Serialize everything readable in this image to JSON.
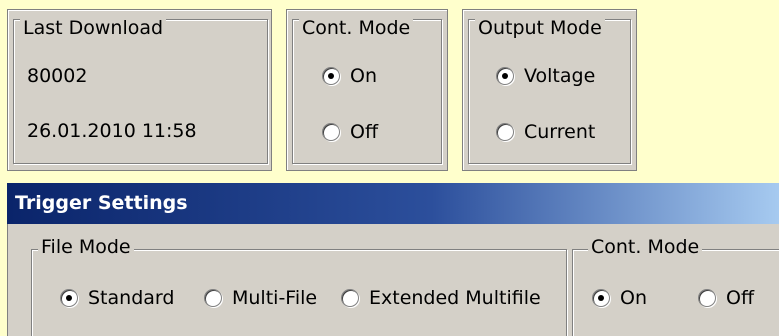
{
  "last_download": {
    "title": "Last Download",
    "id": "80002",
    "timestamp": "26.01.2010 11:58"
  },
  "cont_mode_top": {
    "title": "Cont. Mode",
    "options": [
      {
        "label": "On",
        "selected": true
      },
      {
        "label": "Off",
        "selected": false
      }
    ]
  },
  "output_mode": {
    "title": "Output Mode",
    "options": [
      {
        "label": "Voltage",
        "selected": true
      },
      {
        "label": "Current",
        "selected": false
      }
    ]
  },
  "trigger_settings": {
    "title": "Trigger Settings",
    "file_mode": {
      "title": "File Mode",
      "options": [
        {
          "label": "Standard",
          "selected": true
        },
        {
          "label": "Multi-File",
          "selected": false
        },
        {
          "label": "Extended Multifile",
          "selected": false
        }
      ]
    },
    "cont_mode": {
      "title": "Cont. Mode",
      "options": [
        {
          "label": "On",
          "selected": true
        },
        {
          "label": "Off",
          "selected": false
        }
      ]
    }
  },
  "colors": {
    "background": "#ffffcc",
    "panel": "#d4d0c8",
    "titlebar_start": "#0a246a",
    "titlebar_end": "#a6caf0"
  }
}
